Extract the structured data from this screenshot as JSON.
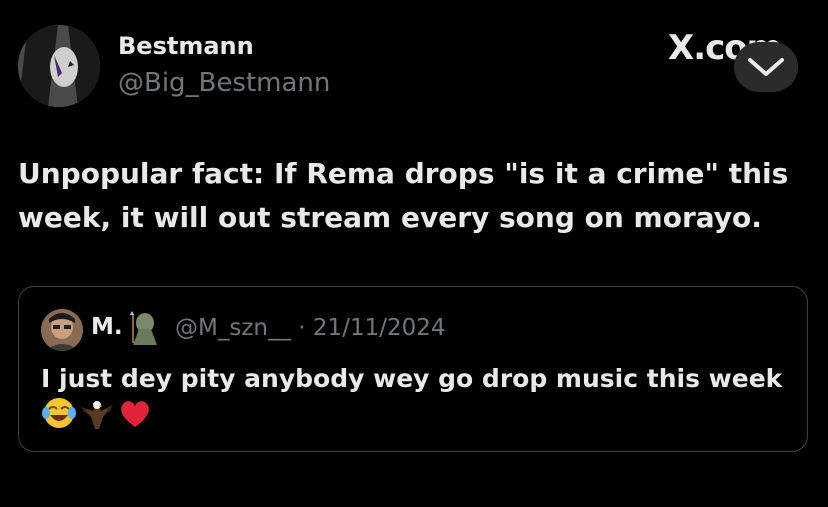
{
  "header": {
    "display_name": "Bestmann",
    "handle": "@Big_Bestmann",
    "logo_text": "X.com"
  },
  "tweet": {
    "text": "Unpopular fact: If Rema drops \"is it a crime\" this week, it will out stream every song on morayo."
  },
  "quote": {
    "name": "M.",
    "handle": "@M_szn__",
    "separator": "·",
    "date": "21/11/2024",
    "text": "I just dey pity anybody wey go drop music this week",
    "emojis": [
      "face-with-tears-of-joy",
      "eagle",
      "red-heart"
    ]
  },
  "icons": {
    "expand": "chevron-down-icon"
  },
  "colors": {
    "background": "#000000",
    "primary_text": "#e7e9ea",
    "secondary_text": "#71767b",
    "card_border": "#3e4144",
    "button_bg": "#2b2b2b"
  }
}
